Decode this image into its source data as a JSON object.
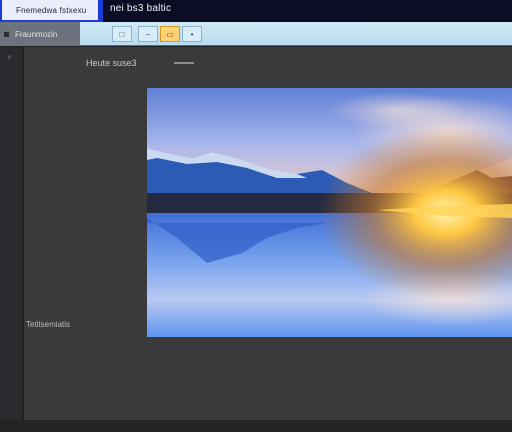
{
  "window": {
    "tab_label": "Fnemedwa fstxexu",
    "title": "nei bs3 baltic"
  },
  "toolbar": {
    "left_label": "Fraunmozin",
    "buttons": [
      {
        "icon": "square-icon",
        "glyph": "□",
        "active": false
      },
      {
        "icon": "dash-icon",
        "glyph": "–",
        "active": false
      },
      {
        "icon": "folder-icon",
        "glyph": "▭",
        "active": true
      },
      {
        "icon": "dot-icon",
        "glyph": "•",
        "active": false
      }
    ]
  },
  "side": {
    "chevron": "˅"
  },
  "panel": {
    "label": "Heute suse3",
    "caption": "Tetitsemiatis"
  },
  "image": {
    "description": "landscape-lake-mountains",
    "colors": {
      "sky_top": "#6b86d8",
      "sky_mid": "#a9b5ea",
      "horizon": "#f2d3c7",
      "water": "#4e86e6",
      "glow": "#ffd56a"
    }
  }
}
